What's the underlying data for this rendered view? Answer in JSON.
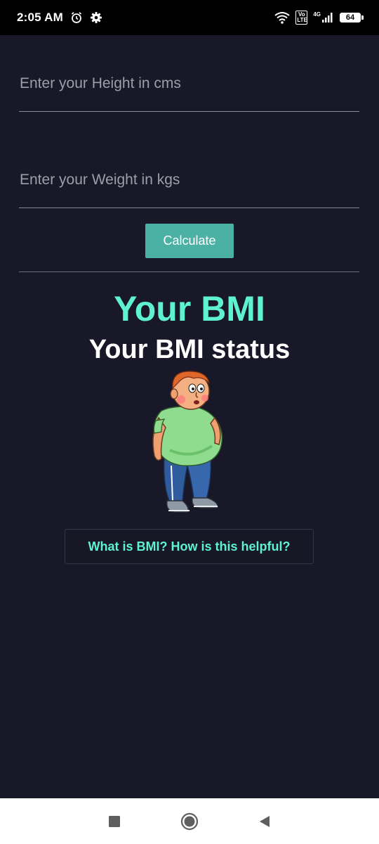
{
  "status_bar": {
    "time": "2:05 AM",
    "volte_label": "Vo LTE",
    "network_type": "4G",
    "battery_level": "64",
    "icons": [
      "alarm-icon",
      "gear-icon",
      "wifi-icon",
      "signal-icon",
      "battery-icon"
    ]
  },
  "form": {
    "height_placeholder": "Enter your Height in cms",
    "height_value": "",
    "weight_placeholder": "Enter your Weight in kgs",
    "weight_value": "",
    "calculate_label": "Calculate"
  },
  "result": {
    "bmi_value": "Your BMI",
    "bmi_status": "Your BMI status",
    "illustration": "overweight-man-illustration"
  },
  "help": {
    "button_label": "What is BMI? How is this helpful?"
  },
  "nav_bar": {
    "icons": [
      "recents-icon",
      "home-icon",
      "back-icon"
    ]
  },
  "colors": {
    "background": "#181828",
    "accent": "#5ef2d2",
    "button": "#4bb1a5"
  }
}
